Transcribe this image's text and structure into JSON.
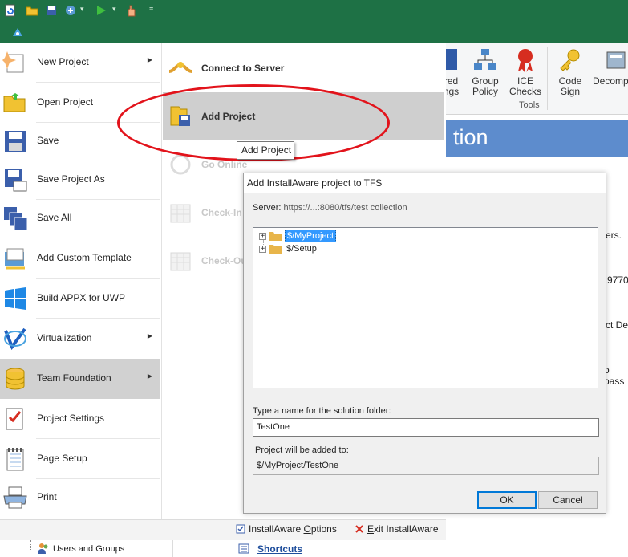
{
  "app_menu": {
    "items": [
      {
        "label": "New Project",
        "icon": "new-project-icon",
        "has_submenu": true
      },
      {
        "label": "Open Project",
        "icon": "open-folder-icon",
        "has_submenu": false
      },
      {
        "label": "Save",
        "icon": "floppy-disk-icon",
        "has_submenu": false
      },
      {
        "label": "Save Project As",
        "icon": "save-as-icon",
        "has_submenu": false
      },
      {
        "label": "Save All",
        "icon": "save-all-icon",
        "has_submenu": false
      },
      {
        "label": "Add Custom Template",
        "icon": "template-icon",
        "has_submenu": false
      },
      {
        "label": "Build APPX for UWP",
        "icon": "windows-logo-icon",
        "has_submenu": false
      },
      {
        "label": "Virtualization",
        "icon": "virtualization-icon",
        "has_submenu": true
      },
      {
        "label": "Team Foundation",
        "icon": "database-icon",
        "has_submenu": true,
        "selected": true
      },
      {
        "label": "Project Settings",
        "icon": "checklist-icon",
        "has_submenu": false
      },
      {
        "label": "Page Setup",
        "icon": "notepad-icon",
        "has_submenu": false
      },
      {
        "label": "Print",
        "icon": "printer-icon",
        "has_submenu": false
      }
    ],
    "submenu": [
      {
        "label": "Connect to Server",
        "icon": "connect-server-icon",
        "enabled": true
      },
      {
        "label": "Add Project",
        "icon": "add-project-icon",
        "enabled": true,
        "highlighted": true
      },
      {
        "label": "Go Online",
        "icon": "go-online-icon",
        "enabled": false
      },
      {
        "label": "Check-In",
        "icon": "check-in-icon",
        "enabled": false
      },
      {
        "label": "Check-Out",
        "icon": "check-out-icon",
        "enabled": false
      }
    ],
    "footer": {
      "options_prefix": "InstallAware ",
      "options_key": "O",
      "options_suffix": "ptions",
      "exit_key": "E",
      "exit_suffix": "xit InstallAware"
    }
  },
  "ribbon": {
    "buttons": [
      {
        "label_line1": "red",
        "label_line2": "ngs"
      },
      {
        "label_line1": "Group",
        "label_line2": "Policy"
      },
      {
        "label_line1": "ICE",
        "label_line2": "Checks"
      },
      {
        "label_line1": "Code",
        "label_line2": "Sign"
      },
      {
        "label_line1": "Decompi",
        "label_line2": ""
      }
    ],
    "group_label": "Tools"
  },
  "background_content": {
    "header": "tion",
    "fragments": [
      "ers.",
      "9770",
      "ct De",
      "o pass"
    ],
    "tree_item": "Users and Groups",
    "shortcuts_link": "Shortcuts"
  },
  "tooltip": {
    "text": "Add Project"
  },
  "dialog": {
    "title": "Add InstallAware project to TFS",
    "server_label": "Server:",
    "server_value": "https://...:8080/tfs/test collection",
    "tree": [
      {
        "label": "$/MyProject",
        "selected": true
      },
      {
        "label": "$/Setup",
        "selected": false
      }
    ],
    "name_label": "Type a name for the solution folder:",
    "name_value": "TestOne",
    "path_label": "Project will be added to:",
    "path_value": "$/MyProject/TestOne",
    "ok_label": "OK",
    "cancel_label": "Cancel"
  },
  "colors": {
    "title_green": "#1e7145",
    "selected_gray": "#d1d1d1",
    "annotation_red": "#e2131b",
    "tree_selection": "#3399ff",
    "content_blue": "#5d8ccd"
  }
}
